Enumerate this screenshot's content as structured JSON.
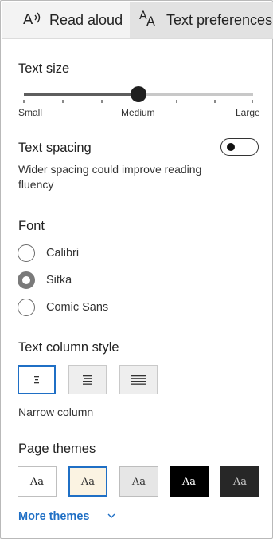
{
  "tabs": {
    "read_aloud": "Read aloud",
    "text_preferences": "Text preferences"
  },
  "text_size": {
    "title": "Text size",
    "min_label": "Small",
    "mid_label": "Medium",
    "max_label": "Large",
    "value_fraction": 0.5
  },
  "text_spacing": {
    "title": "Text spacing",
    "description_line1": "Wider spacing could improve reading",
    "description_line2": "fluency",
    "enabled": false
  },
  "font": {
    "title": "Font",
    "options": [
      "Calibri",
      "Sitka",
      "Comic Sans"
    ],
    "selected": "Sitka"
  },
  "column_style": {
    "title": "Text column style",
    "options": [
      "narrow",
      "medium",
      "wide"
    ],
    "selected": "narrow",
    "selected_label": "Narrow column"
  },
  "page_themes": {
    "title": "Page themes",
    "swatch_text": "Aa",
    "themes": [
      {
        "bg": "#ffffff",
        "fg": "#222222",
        "border": "#bfbfbf"
      },
      {
        "bg": "#fbf3e2",
        "fg": "#333333",
        "border": "#1f6fc5"
      },
      {
        "bg": "#e6e6e6",
        "fg": "#333333",
        "border": "#bdbdbd"
      },
      {
        "bg": "#000000",
        "fg": "#ffffff",
        "border": "#000000"
      },
      {
        "bg": "#272727",
        "fg": "#c8c8c8",
        "border": "#272727"
      }
    ],
    "more_label": "More themes"
  },
  "colors": {
    "accent": "#1f6fc5",
    "tab_bar": "#f3f3f3",
    "tab_selected": "#e2e2e2"
  },
  "icons": {
    "read_aloud": "read-aloud-icon",
    "text_preferences": "text-preferences-icon",
    "more_themes": "chevron-down-icon"
  }
}
